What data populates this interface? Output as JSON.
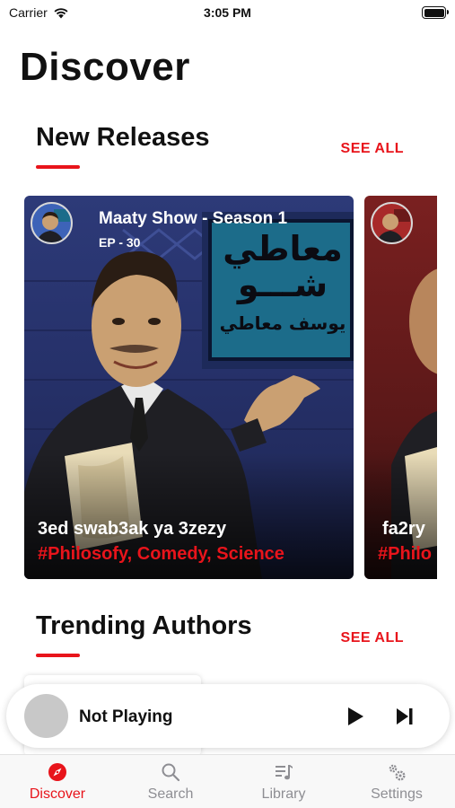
{
  "status": {
    "carrier": "Carrier",
    "time": "3:05 PM"
  },
  "page": {
    "title": "Discover"
  },
  "new_releases": {
    "title": "New Releases",
    "see_all": "SEE ALL",
    "cards": [
      {
        "show": "Maaty Show - Season 1",
        "episode": "EP - 30",
        "title": "3ed swab3ak ya 3zezy",
        "tags": "#Philosofy, Comedy, Science",
        "sign_line1": "معاطي",
        "sign_line2": "شـــو",
        "sign_line3": "يوسف معاطي"
      },
      {
        "title": "fa2ry",
        "tags": "#Philo"
      }
    ]
  },
  "trending_authors": {
    "title": "Trending Authors",
    "see_all": "SEE ALL"
  },
  "player": {
    "status": "Not Playing"
  },
  "tabs": [
    {
      "label": "Discover",
      "icon": "compass-icon",
      "active": true
    },
    {
      "label": "Search",
      "icon": "search-icon",
      "active": false
    },
    {
      "label": "Library",
      "icon": "music-list-icon",
      "active": false
    },
    {
      "label": "Settings",
      "icon": "gear-icon",
      "active": false
    }
  ],
  "colors": {
    "accent": "#e8141b",
    "card_bg": "#26316a"
  }
}
